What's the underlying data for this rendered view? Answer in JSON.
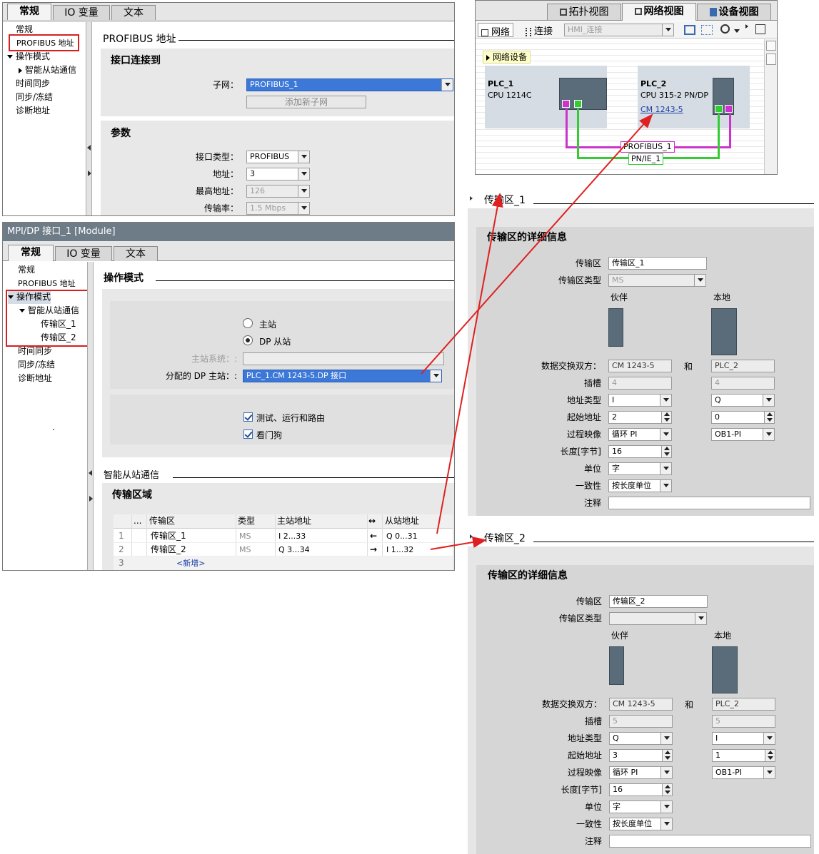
{
  "tabs": {
    "general": "常规",
    "io_tags": "IO 变量",
    "text": "文本"
  },
  "p1": {
    "nav": {
      "general": "常规",
      "profibus_addr": "PROFIBUS 地址",
      "op_mode": "操作模式",
      "islave": "智能从站通信",
      "time_sync": "时间同步",
      "sync_freeze": "同步/冻结",
      "diag": "诊断地址"
    },
    "section_title": "PROFIBUS 地址",
    "iface_title": "接口连接到",
    "subnet_label": "子网：",
    "subnet_value": "PROFIBUS_1",
    "add_subnet": "添加新子网",
    "params_title": "参数",
    "iface_type_label": "接口类型：",
    "iface_type_value": "PROFIBUS",
    "addr_label": "地址：",
    "addr_value": "3",
    "max_addr_label": "最高地址：",
    "max_addr_value": "126",
    "rate_label": "传输率：",
    "rate_value": "1.5 Mbps"
  },
  "p2": {
    "title": "MPI/DP 接口_1 [Module]",
    "nav": {
      "general": "常规",
      "profibus_addr": "PROFIBUS 地址",
      "op_mode": "操作模式",
      "islave": "智能从站通信",
      "ta1": "传输区_1",
      "ta2": "传输区_2",
      "time_sync": "时间同步",
      "sync_freeze": "同步/冻结",
      "diag": "诊断地址",
      "dot": "."
    },
    "section_title": "操作模式",
    "radio_master": "主站",
    "radio_dpslave": "DP 从站",
    "master_sys_label": "主站系统：:",
    "assigned_master_label": "分配的 DP 主站：:",
    "assigned_master_value": "PLC_1.CM 1243-5.DP 接口",
    "chk_test": "测试、运行和路由",
    "chk_watchdog": "看门狗",
    "islave_title": "智能从站通信",
    "transfer_title": "传输区域",
    "table": {
      "headers": [
        "...",
        "传输区",
        "类型",
        "主站地址",
        "↔",
        "从站地址"
      ],
      "rows": [
        {
          "num": "1",
          "name": "传输区_1",
          "type": "MS",
          "master": "I 2...33",
          "arrow": "←",
          "slave": "Q 0...31"
        },
        {
          "num": "2",
          "name": "传输区_2",
          "type": "MS",
          "master": "Q 3...34",
          "arrow": "→",
          "slave": "I 1...32"
        },
        {
          "num": "3",
          "name": "<新增>",
          "type": "",
          "master": "",
          "arrow": "",
          "slave": ""
        }
      ]
    }
  },
  "net": {
    "view_tabs": {
      "topo": "拓扑视图",
      "network": "网络视图",
      "device": "设备视图"
    },
    "toolbar": {
      "network": "网络",
      "connection": "连接",
      "conn_type": "HMI_连接"
    },
    "net_devices": "网络设备",
    "plc1": {
      "name": "PLC_1",
      "cpu": "CPU 1214C"
    },
    "plc2": {
      "name": "PLC_2",
      "cpu": "CPU 315-2 PN/DP",
      "cm": "CM 1243-5"
    },
    "profibus": "PROFIBUS_1",
    "pnie": "PN/IE_1",
    "colors": {
      "profibus": "#cc33cc",
      "pnie": "#33cc33"
    }
  },
  "ta1": {
    "header": "传输区_1",
    "details": "传输区的详细信息",
    "ta_label": "传输区",
    "ta_value": "传输区_1",
    "type_label": "传输区类型",
    "type_value": "MS",
    "partner": "伙伴",
    "local": "本地",
    "exchange_label": "数据交换双方：",
    "exchange_left": "CM 1243-5",
    "and": "和",
    "exchange_right": "PLC_2",
    "slot_label": "插槽",
    "slot_left": "4",
    "slot_right": "4",
    "addrtype_label": "地址类型",
    "addrtype_left": "I",
    "addrtype_right": "Q",
    "start_label": "起始地址",
    "start_left": "2",
    "start_right": "0",
    "pi_label": "过程映像",
    "pi_left": "循环 PI",
    "pi_right": "OB1-PI",
    "len_label": "长度[字节]",
    "len_value": "16",
    "unit_label": "单位",
    "unit_value": "字",
    "cons_label": "一致性",
    "cons_value": "按长度单位",
    "comment_label": "注释"
  },
  "ta2": {
    "header": "传输区_2",
    "details": "传输区的详细信息",
    "ta_label": "传输区",
    "ta_value": "传输区_2",
    "type_label": "传输区类型",
    "type_value": "",
    "partner": "伙伴",
    "local": "本地",
    "exchange_label": "数据交换双方：",
    "exchange_left": "CM 1243-5",
    "and": "和",
    "exchange_right": "PLC_2",
    "slot_label": "插槽",
    "slot_left": "5",
    "slot_right": "5",
    "addrtype_label": "地址类型",
    "addrtype_left": "Q",
    "addrtype_right": "I",
    "start_label": "起始地址",
    "start_left": "3",
    "start_right": "1",
    "pi_label": "过程映像",
    "pi_left": "循环 PI",
    "pi_right": "OB1-PI",
    "len_label": "长度[字节]",
    "len_value": "16",
    "unit_label": "单位",
    "unit_value": "字",
    "cons_label": "一致性",
    "cons_value": "按长度单位",
    "comment_label": "注释"
  }
}
